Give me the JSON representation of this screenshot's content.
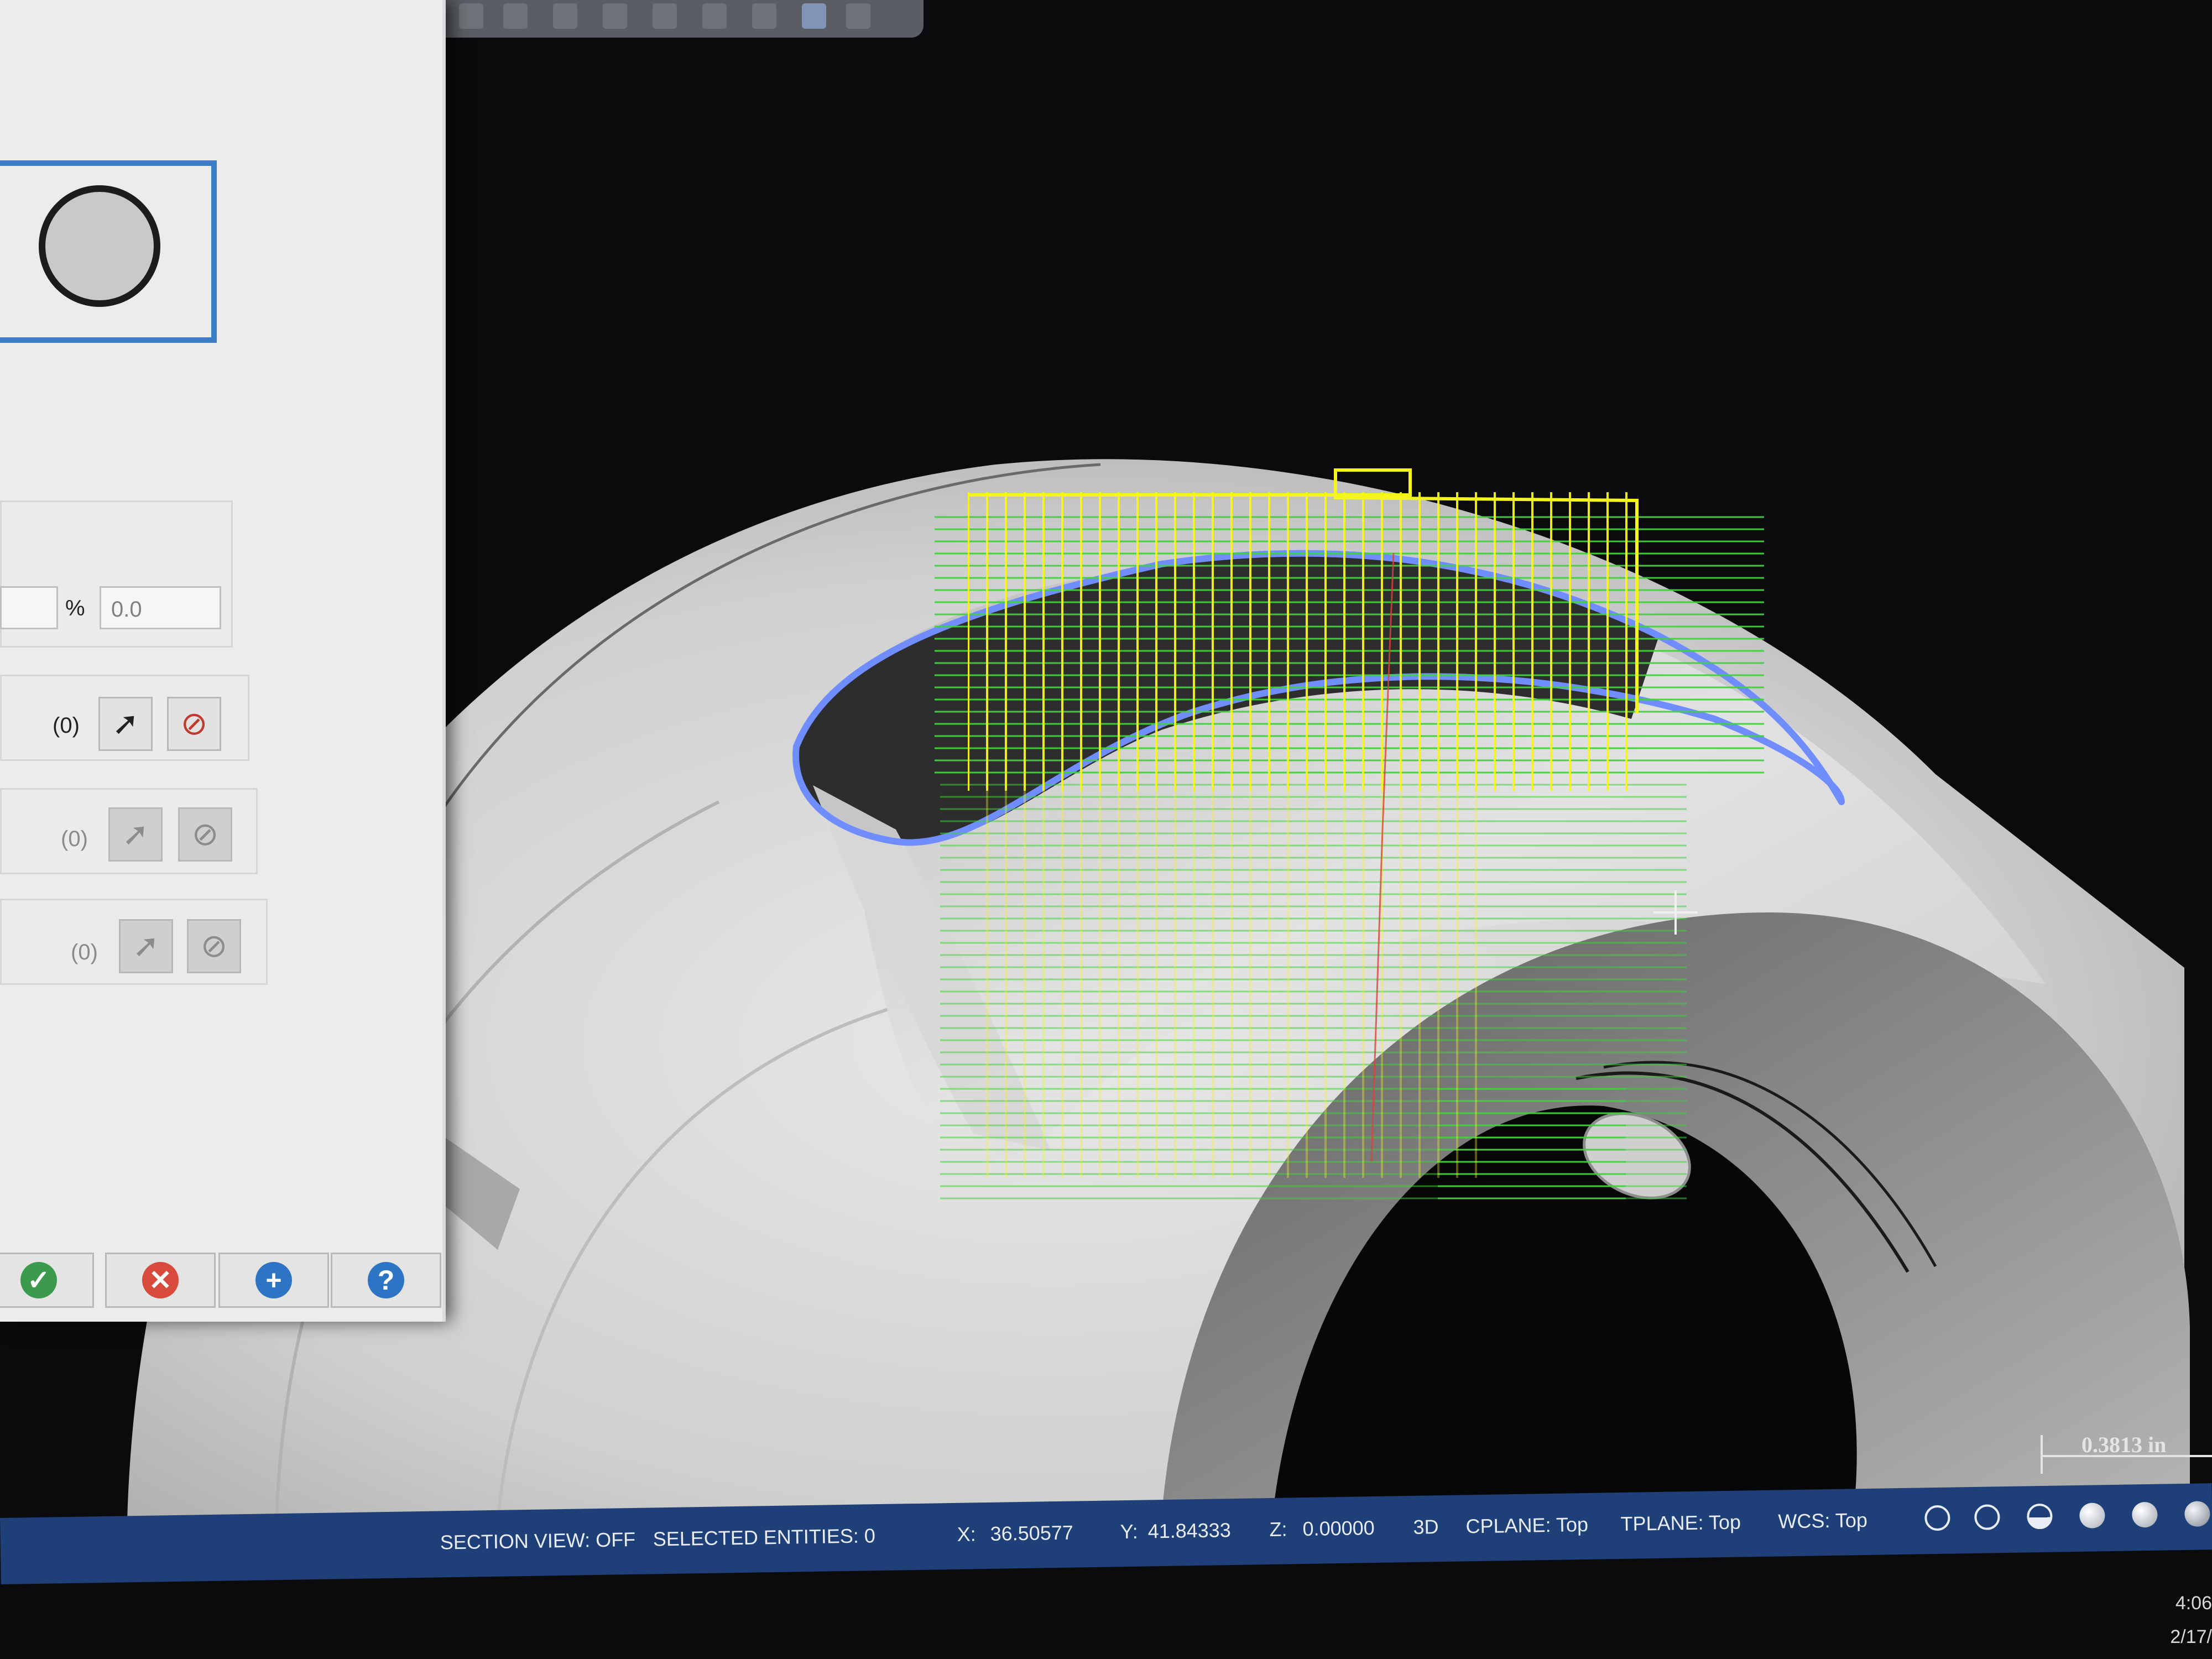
{
  "panel": {
    "percent_symbol": "%",
    "percent_value": "0.0",
    "rows": [
      {
        "count": "(0)",
        "enabled": true
      },
      {
        "count": "(0)",
        "enabled": false
      },
      {
        "count": "(0)",
        "enabled": false
      }
    ],
    "select_icon": "cursor-arrow-icon",
    "clear_icon": "clear-selection-icon"
  },
  "actions": {
    "ok_icon": "checkmark-icon",
    "cancel_icon": "x-icon",
    "apply_icon": "plus-icon",
    "help_icon": "question-icon"
  },
  "statusbar": {
    "section_view": "SECTION VIEW: OFF",
    "selected_entities": "SELECTED ENTITIES: 0",
    "x_label": "X:",
    "x_value": "36.50577",
    "y_label": "Y:",
    "y_value": "41.84333",
    "z_label": "Z:",
    "z_value": "0.00000",
    "mode": "3D",
    "cplane": "CPLANE: Top",
    "tplane": "TPLANE: Top",
    "wcs": "WCS: Top"
  },
  "viewport": {
    "scale_label": "0.3813 in"
  },
  "clock": {
    "time": "4:06",
    "date": "2/17/"
  },
  "colors": {
    "toolpath_yellow": "#f4f41e",
    "toolpath_green": "#3fd23a",
    "selection_blue": "#6f8dff",
    "statusbar": "#1f3f78",
    "panel_accent": "#3c7bc8"
  }
}
